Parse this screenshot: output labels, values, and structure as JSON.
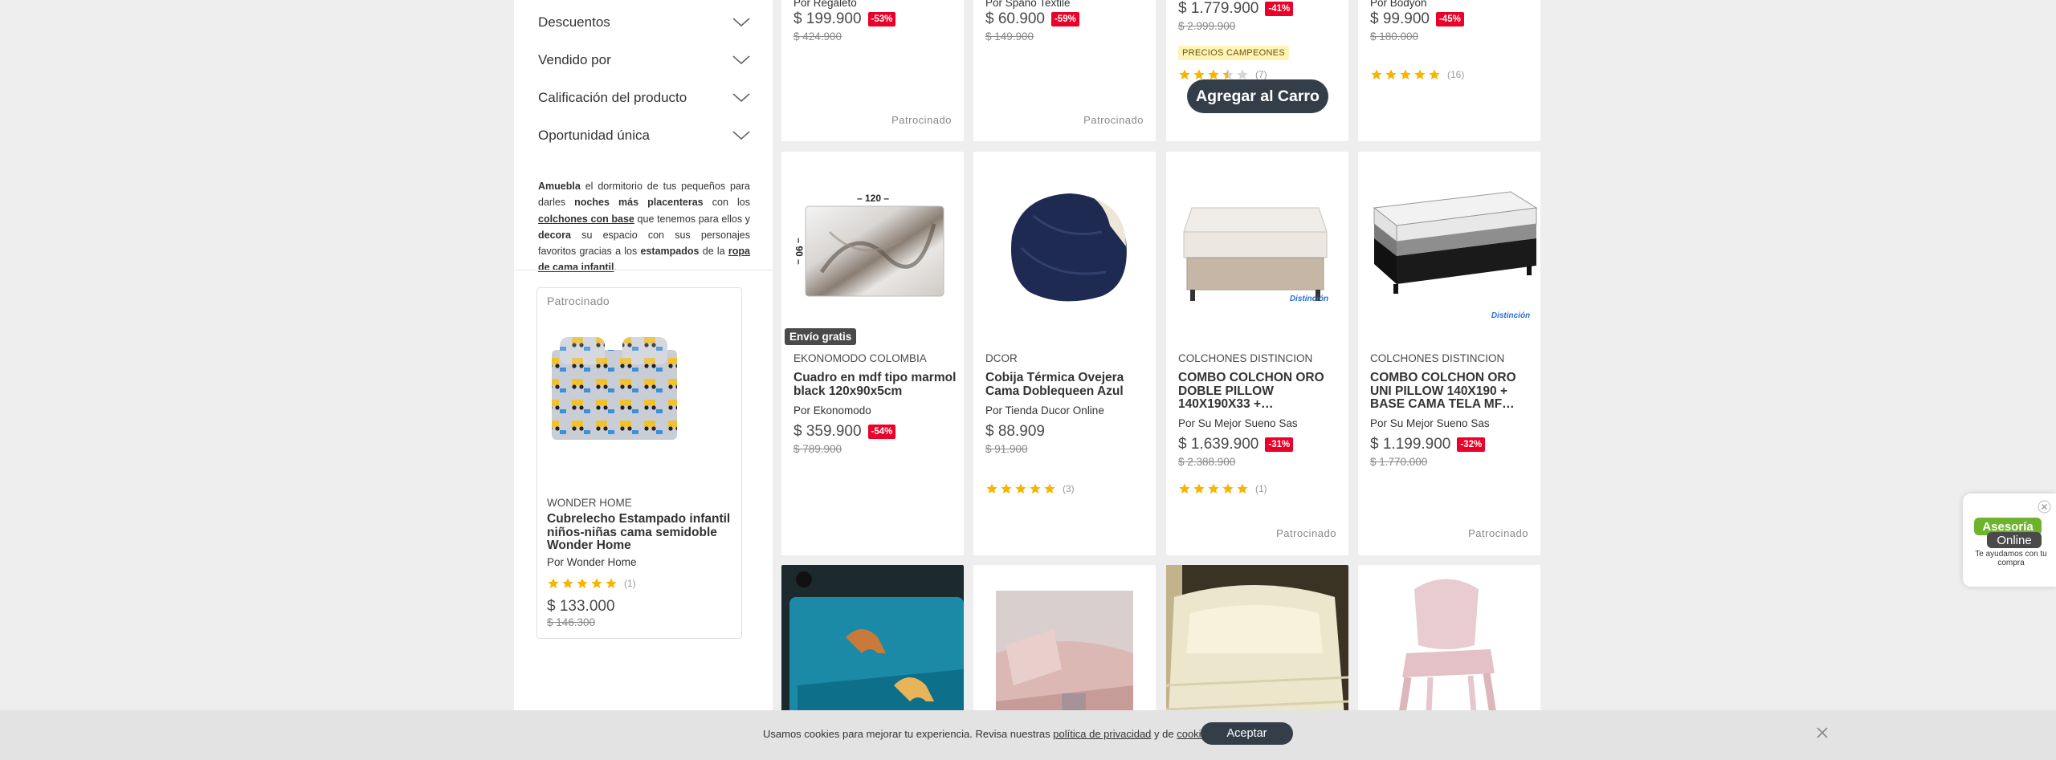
{
  "filters": {
    "descuentos": "Descuentos",
    "vendido_por": "Vendido por",
    "calificacion": "Calificación del producto",
    "oportunidad": "Oportunidad única"
  },
  "promo": {
    "p1": "Amuebla",
    "p2": " el dormitorio de tus pequeños para darles ",
    "p3": "noches más placenteras",
    "p4": " con los ",
    "p5": "colchones con base",
    "p6": " que tenemos para ellos y ",
    "p7": "decora",
    "p8": " su espacio con sus personajes favoritos gracias a los ",
    "p9": "estampados",
    "p10": " de la ",
    "p11": "ropa de cama infantil",
    "p12": "."
  },
  "sponsored_side": {
    "tag": "Patrocinado",
    "brand": "WONDER HOME",
    "title": "Cubrelecho Estampado infantil niños-niñas cama semidoble Wonder Home",
    "seller": "Por Wonder Home",
    "rating_count": "(1)",
    "price": "$ 133.000",
    "old_price": "$ 146.300"
  },
  "top_row": [
    {
      "seller": "Por Regaleto",
      "price": "$ 199.900",
      "discount": "-53%",
      "old_price": "$ 424.900",
      "sponsored": "Patrocinado"
    },
    {
      "seller": "Por Spano Textile",
      "price": "$ 60.900",
      "discount": "-59%",
      "old_price": "$ 149.900",
      "sponsored": "Patrocinado"
    },
    {
      "price": "$ 1.779.900",
      "discount": "-41%",
      "old_price": "$ 2.999.900",
      "campeones": "PRECIOS CAMPEONES",
      "rating_count": "(7)",
      "rating": 3.5,
      "cart_button": "Agregar al Carro"
    },
    {
      "seller": "Por Bodyon",
      "price": "$ 99.900",
      "discount": "-45%",
      "old_price": "$ 180.000",
      "rating_count": "(16)",
      "rating": 5
    }
  ],
  "products": [
    {
      "brand": "EKONOMODO COLOMBIA",
      "title": "Cuadro en mdf tipo marmol black 120x90x5cm",
      "seller": "Por Ekonomodo",
      "price": "$ 359.900",
      "discount": "-54%",
      "old_price": "$ 789.900",
      "envio": "Envío gratis",
      "img_top": "– 120 –",
      "img_side": "– 90 –"
    },
    {
      "brand": "DCOR",
      "title": "Cobija Térmica Ovejera Cama Doblequeen Azul",
      "seller": "Por Tienda Ducor Online",
      "price": "$ 88.909",
      "old_price": "$ 91.900",
      "rating_count": "(3)",
      "rating": 5
    },
    {
      "brand": "COLCHONES DISTINCION",
      "title": "COMBO COLCHON ORO DOBLE PILLOW 140X190X33 +…",
      "seller": "Por Su Mejor Sueno Sas",
      "price": "$ 1.639.900",
      "discount": "-31%",
      "old_price": "$ 2.388.900",
      "rating_count": "(1)",
      "rating": 5,
      "sponsored": "Patrocinado",
      "logo": "Distinción"
    },
    {
      "brand": "COLCHONES DISTINCION",
      "title": "COMBO COLCHON ORO UNI PILLOW 140X190 + BASE CAMA TELA MF…",
      "seller": "Por Su Mejor Sueno Sas",
      "price": "$ 1.199.900",
      "discount": "-32%",
      "old_price": "$ 1.770.000",
      "sponsored": "Patrocinado",
      "logo": "Distinción"
    }
  ],
  "cookie": {
    "text1": "Usamos cookies para mejorar tu experiencia. Revisa nuestras ",
    "link1": "política de privacidad",
    "text2": " y de ",
    "link2": "cookies",
    "text3": ".",
    "accept": "Aceptar"
  },
  "asesoria": {
    "line1": "Asesoría",
    "line2": "Online",
    "caption": "Te ayudamos con tu compra"
  },
  "colors": {
    "discount": "#eb0029",
    "button": "#343e49",
    "star": "#f7b500",
    "asesoria_green": "#6fb22d"
  }
}
